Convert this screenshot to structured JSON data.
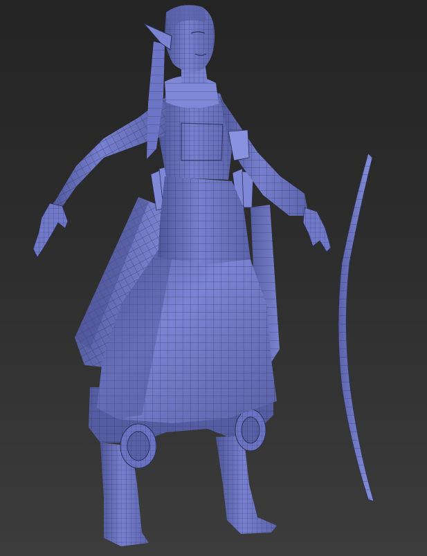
{
  "viewport": {
    "background_top": "#242424",
    "background_bottom": "#3c3c3c"
  },
  "model": {
    "base_color": "#6f78c9",
    "shadow_color": "#4a528f",
    "highlight_color": "#8e97e0",
    "wire_color": "#2a2f55",
    "display_mode": "wireframe-on-shaded"
  }
}
